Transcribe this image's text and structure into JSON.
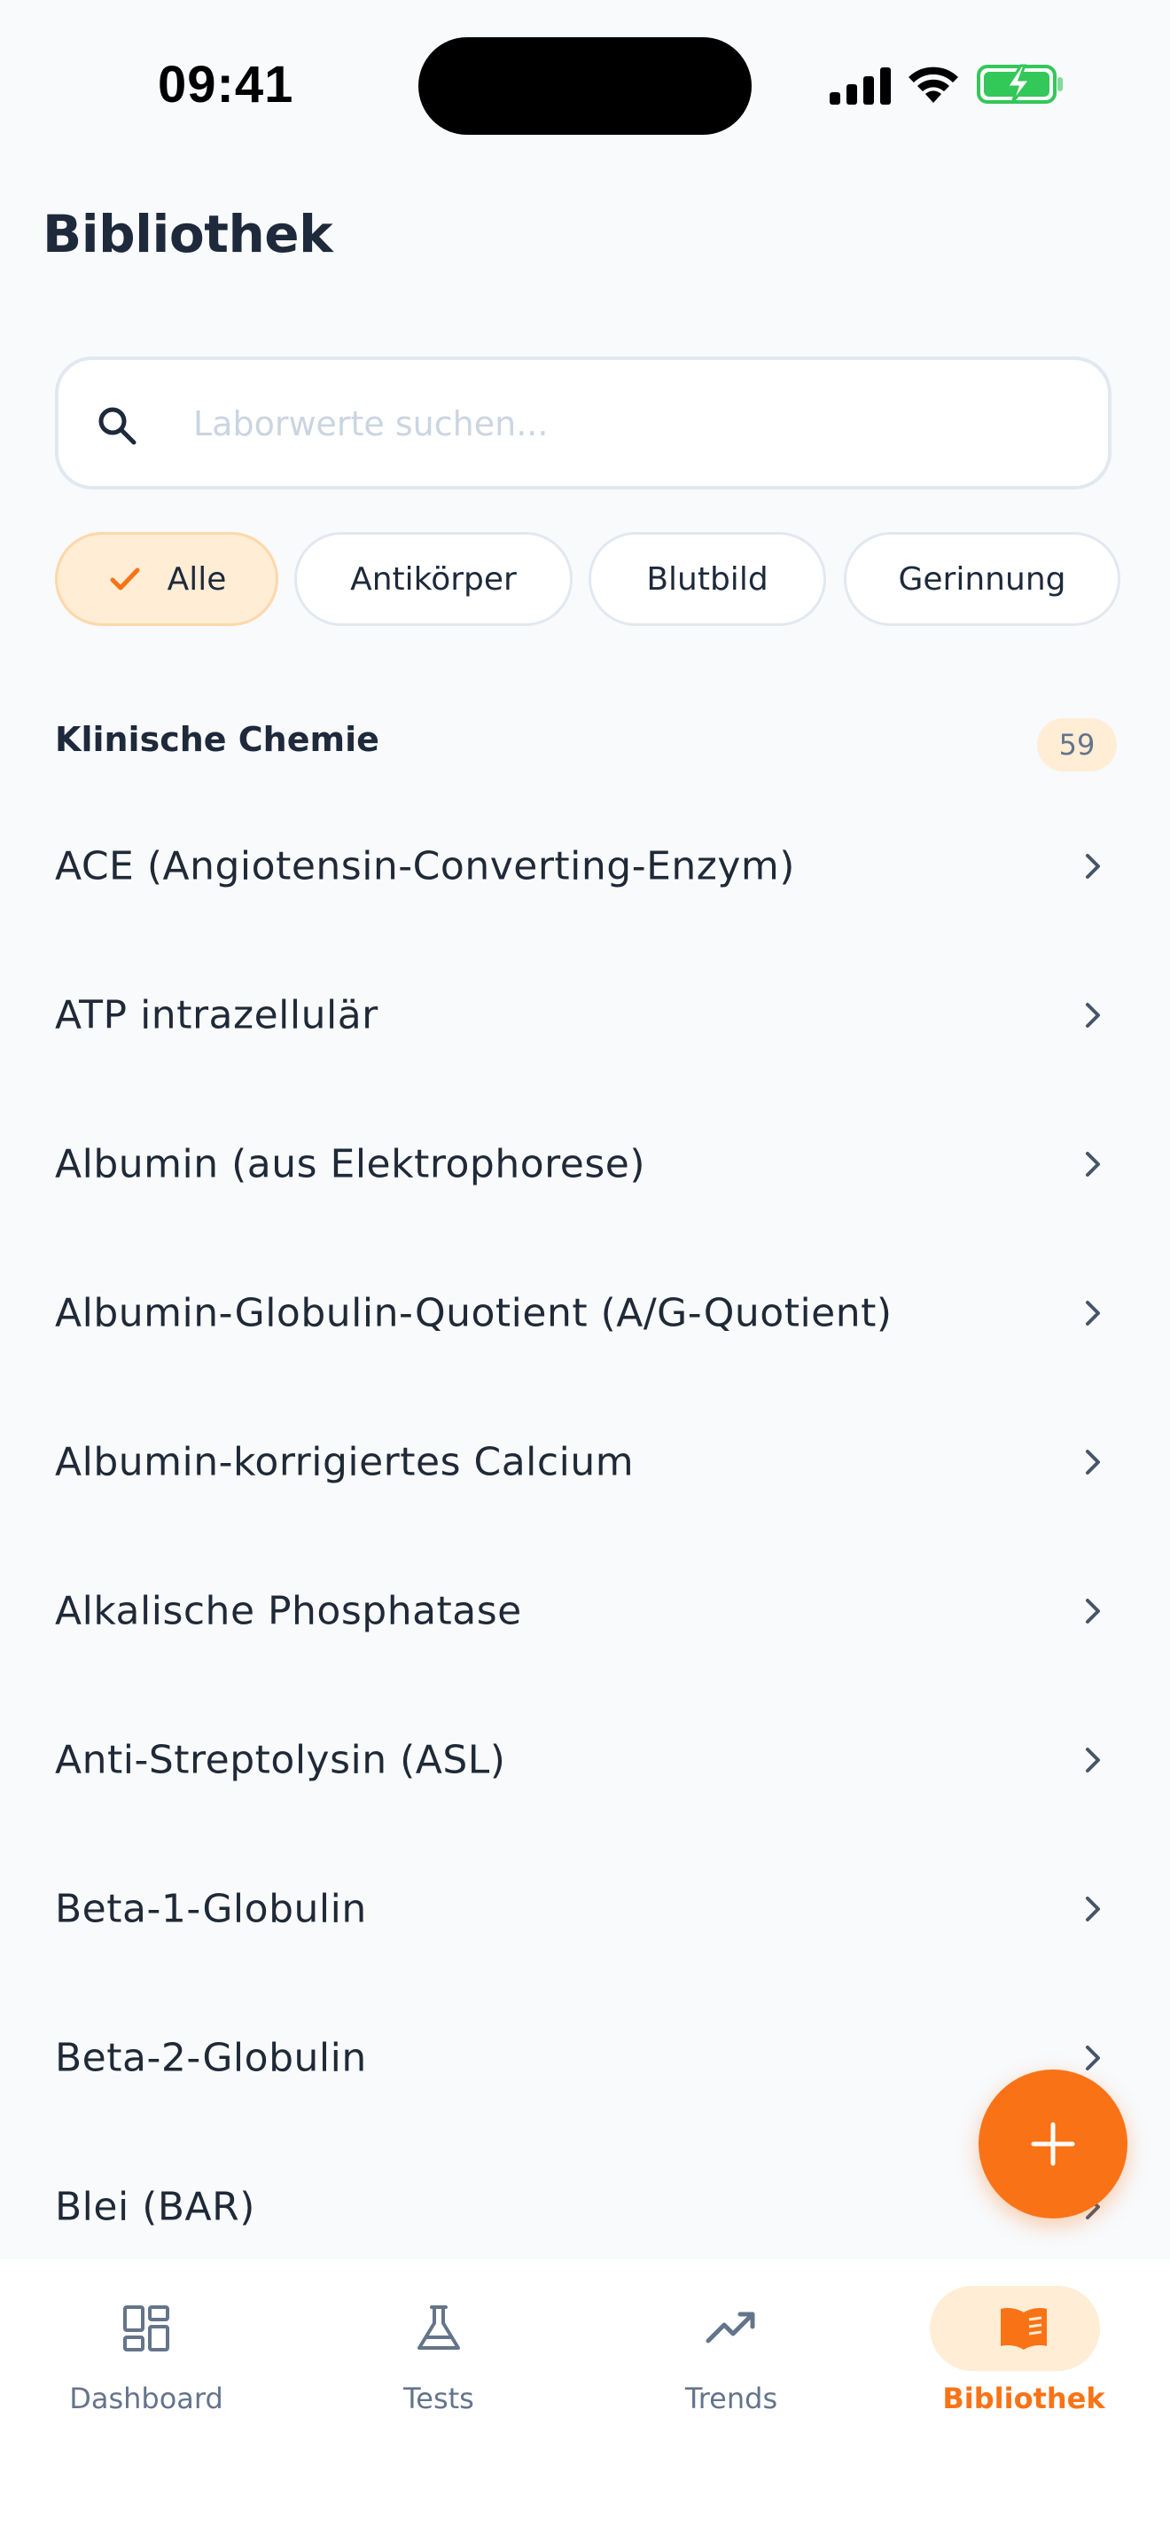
{
  "status_bar": {
    "time": "09:41"
  },
  "header": {
    "title": "Bibliothek"
  },
  "search": {
    "placeholder": "Laborwerte suchen..."
  },
  "filters": [
    {
      "label": "Alle",
      "selected": true
    },
    {
      "label": "Antikörper",
      "selected": false
    },
    {
      "label": "Blutbild",
      "selected": false
    },
    {
      "label": "Gerinnung",
      "selected": false
    }
  ],
  "section": {
    "title": "Klinische Chemie",
    "count": "59"
  },
  "items": [
    "ACE (Angiotensin-Converting-Enzym)",
    "ATP intrazellulär",
    "Albumin (aus Elektrophorese)",
    "Albumin-Globulin-Quotient (A/G-Quotient)",
    "Albumin-korrigiertes Calcium",
    "Alkalische Phosphatase",
    "Anti-Streptolysin (ASL)",
    "Beta-1-Globulin",
    "Beta-2-Globulin",
    "Blei (BAR)"
  ],
  "nav": [
    {
      "label": "Dashboard",
      "icon": "dashboard-icon",
      "active": false
    },
    {
      "label": "Tests",
      "icon": "flask-icon",
      "active": false
    },
    {
      "label": "Trends",
      "icon": "trending-up-icon",
      "active": false
    },
    {
      "label": "Bibliothek",
      "icon": "book-icon",
      "active": true
    }
  ],
  "colors": {
    "accent": "#F97316",
    "accent_light": "#FFEDD5",
    "text": "#1F2937",
    "muted": "#64748B",
    "background": "#F8FAFC"
  }
}
